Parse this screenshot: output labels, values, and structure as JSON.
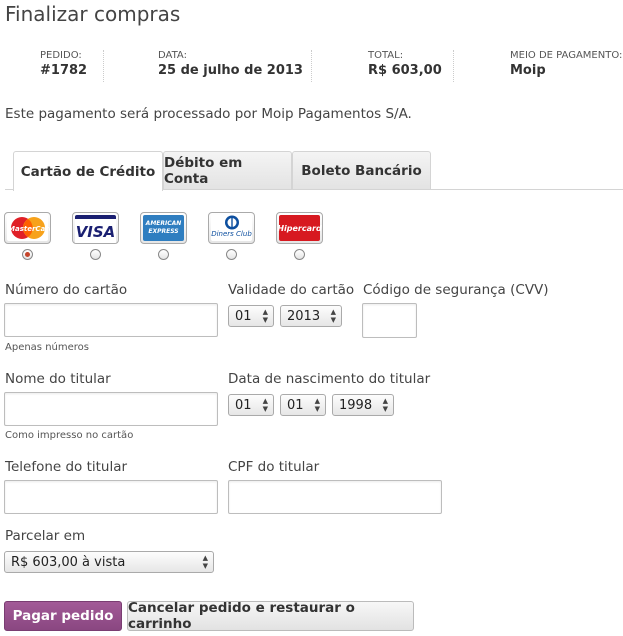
{
  "page": {
    "title": "Finalizar compras"
  },
  "summary": {
    "order_label": "PEDIDO:",
    "order_value": "#1782",
    "date_label": "DATA:",
    "date_value": "25 de julho de 2013",
    "total_label": "TOTAL:",
    "total_value": "R$ 603,00",
    "method_label": "MEIO DE PAGAMENTO:",
    "method_value": "Moip"
  },
  "notice": "Este pagamento será processado por Moip Pagamentos S/A.",
  "tabs": [
    {
      "label": "Cartão de Crédito",
      "active": true
    },
    {
      "label": "Débito em Conta",
      "active": false
    },
    {
      "label": "Boleto Bancário",
      "active": false
    }
  ],
  "cards": [
    {
      "name": "MasterCard",
      "selected": true
    },
    {
      "name": "VISA",
      "selected": false
    },
    {
      "name": "AMERICAN EXPRESS",
      "selected": false
    },
    {
      "name": "Diners Club",
      "selected": false
    },
    {
      "name": "Hipercard",
      "selected": false
    }
  ],
  "form": {
    "card_number_label": "Número do cartão",
    "card_number_hint": "Apenas números",
    "card_number_value": "",
    "expiry_label": "Validade do cartão",
    "expiry_month": "01",
    "expiry_year": "2013",
    "cvv_label": "Código de segurança (CVV)",
    "cvv_value": "",
    "holder_name_label": "Nome do titular",
    "holder_name_hint": "Como impresso no cartão",
    "holder_name_value": "",
    "birth_label": "Data de nascimento do titular",
    "birth_day": "01",
    "birth_month": "01",
    "birth_year": "1998",
    "phone_label": "Telefone do titular",
    "phone_value": "",
    "cpf_label": "CPF do titular",
    "cpf_value": "",
    "installments_label": "Parcelar em",
    "installments_value": "R$ 603,00 à vista"
  },
  "buttons": {
    "pay": "Pagar pedido",
    "cancel": "Cancelar pedido e restaurar o carrinho"
  },
  "colors": {
    "primary_button": "#8e4b85",
    "radio_selected": "#c5442a"
  }
}
